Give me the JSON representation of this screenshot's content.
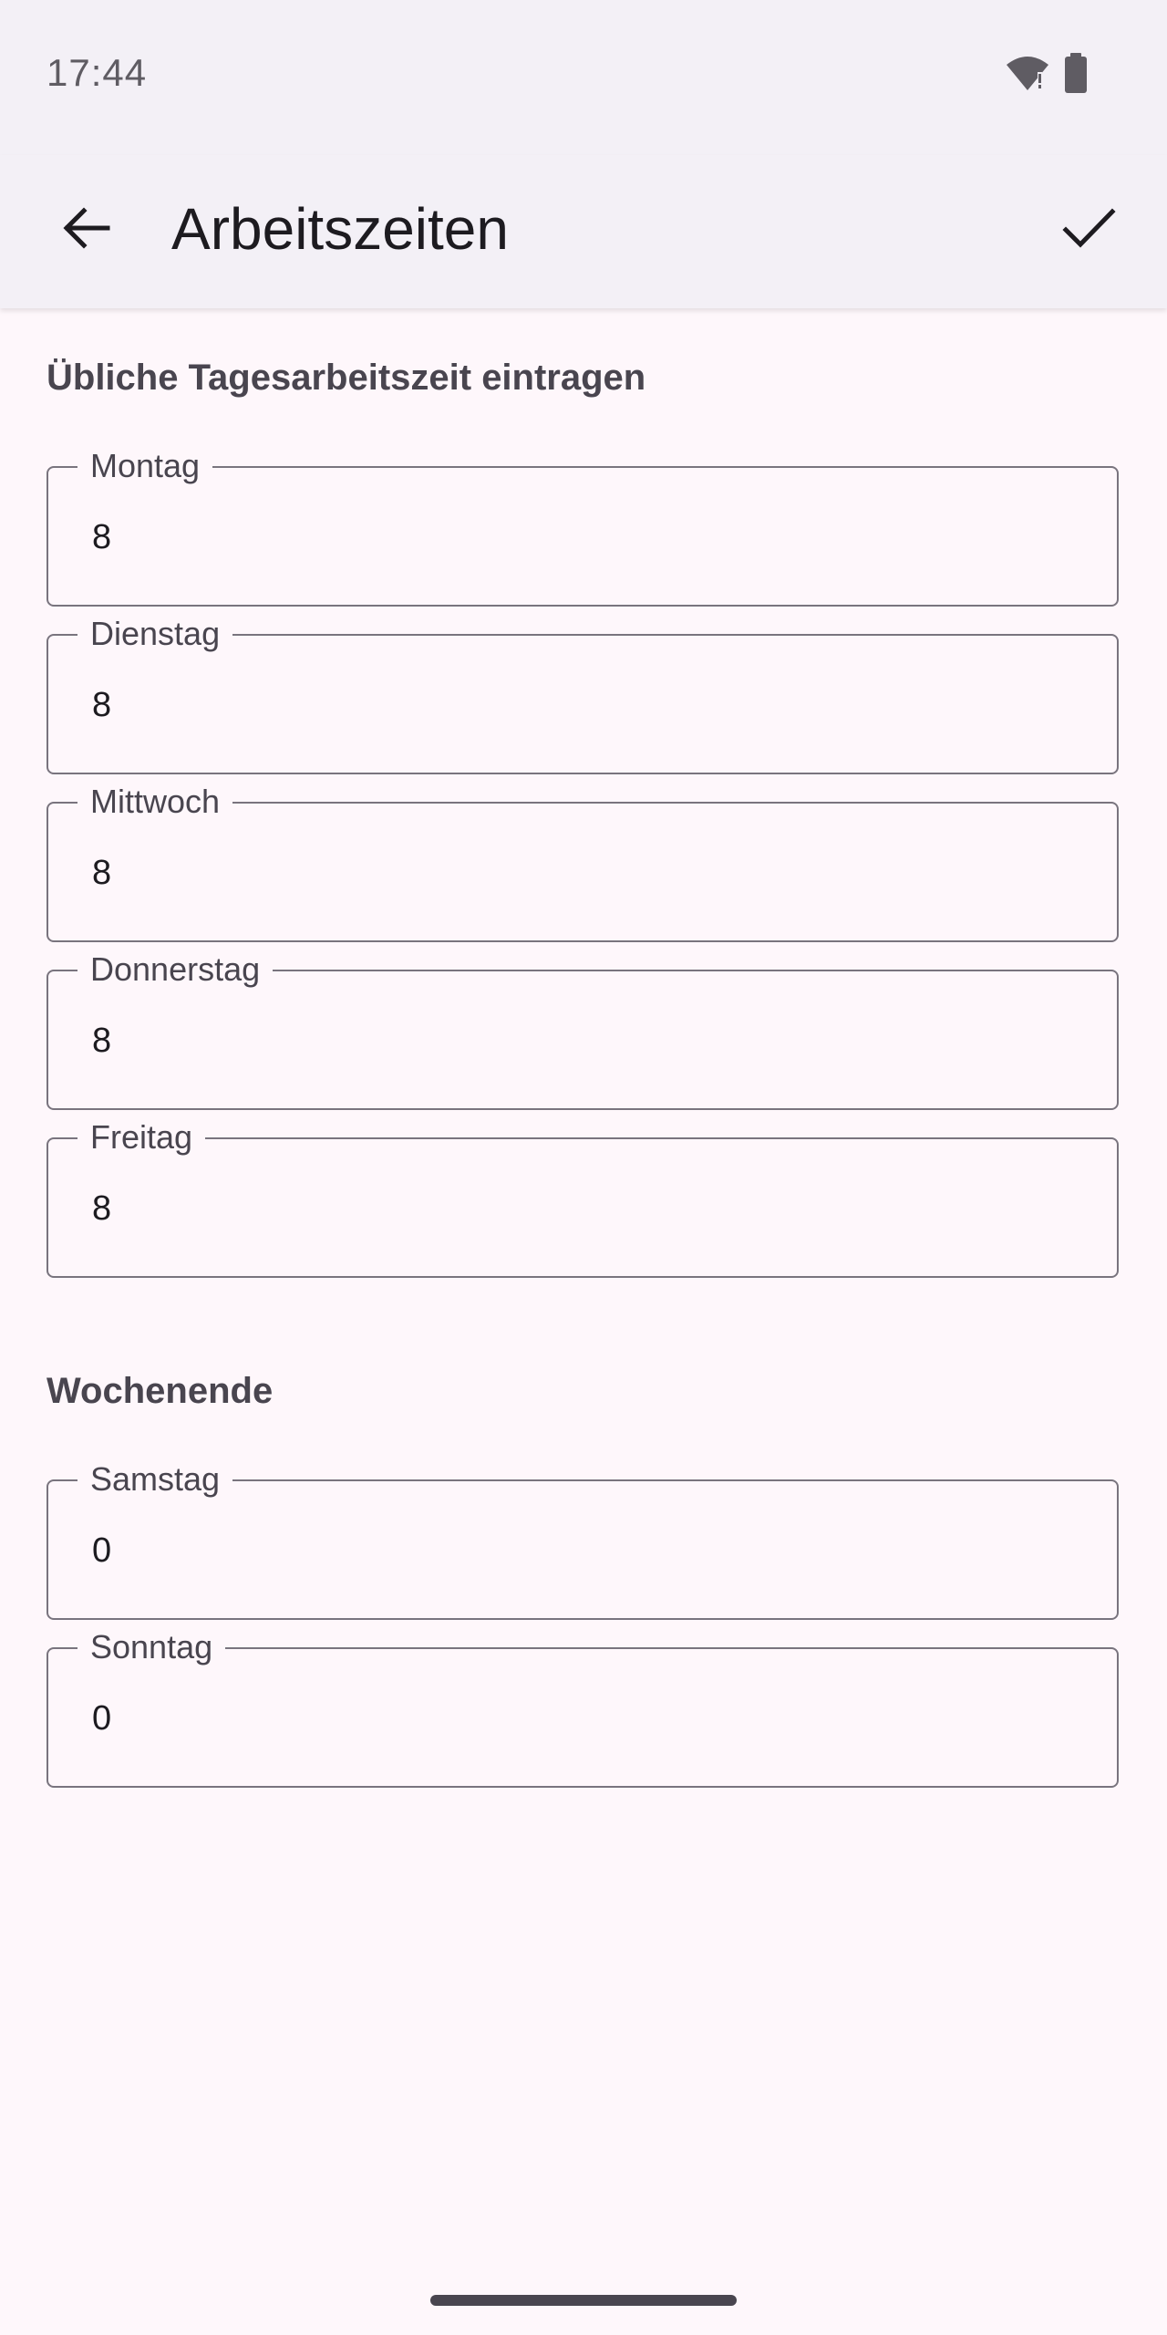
{
  "status_bar": {
    "time": "17:44",
    "icons": [
      "wifi-icon",
      "battery-icon"
    ]
  },
  "app_bar": {
    "title": "Arbeitszeiten",
    "back_icon": "arrow-back-icon",
    "confirm_icon": "check-icon"
  },
  "weekdays": {
    "heading": "Übliche Tagesarbeitszeit eintragen",
    "fields": [
      {
        "label": "Montag",
        "value": "8"
      },
      {
        "label": "Dienstag",
        "value": "8"
      },
      {
        "label": "Mittwoch",
        "value": "8"
      },
      {
        "label": "Donnerstag",
        "value": "8"
      },
      {
        "label": "Freitag",
        "value": "8"
      }
    ]
  },
  "weekend": {
    "heading": "Wochenende",
    "fields": [
      {
        "label": "Samstag",
        "value": "0"
      },
      {
        "label": "Sonntag",
        "value": "0"
      }
    ]
  },
  "colors": {
    "background": "#fef7fb",
    "app_bar": "#f3f0f6",
    "outline": "#79747e",
    "label_text": "#49454f",
    "primary_text": "#1d1b20"
  }
}
